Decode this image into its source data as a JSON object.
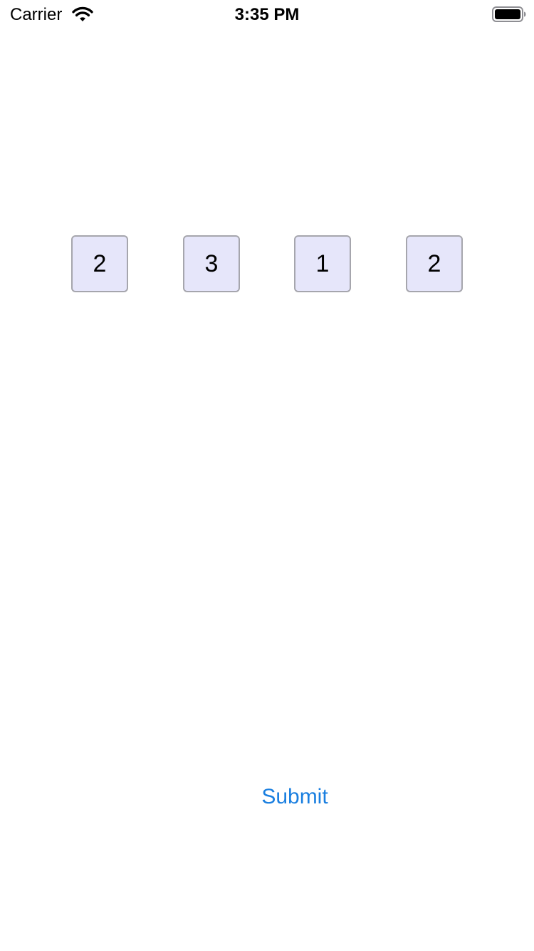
{
  "status_bar": {
    "carrier": "Carrier",
    "time": "3:35 PM",
    "wifi_icon": "wifi-icon",
    "battery_icon": "battery-full-icon"
  },
  "digits": [
    "2",
    "3",
    "1",
    "2"
  ],
  "submit": {
    "label": "Submit",
    "color": "#1a7fe0"
  },
  "colors": {
    "digit_box_fill": "#e6e6fa",
    "digit_box_border": "#a6a6ad"
  }
}
